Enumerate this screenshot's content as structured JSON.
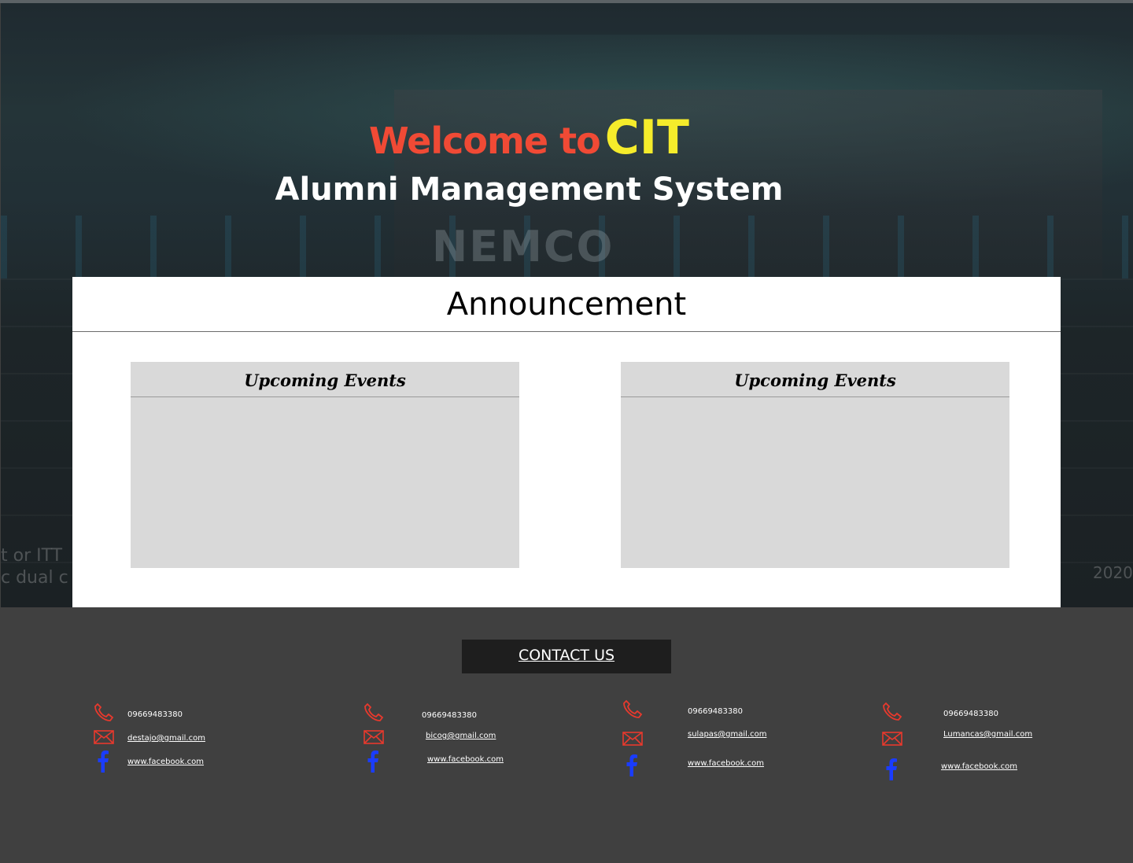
{
  "hero": {
    "welcome_text": "Welcome to",
    "brand_text": "CIT",
    "subtitle": "Alumni Management System",
    "bg_watermark": "NEMCO",
    "bg_side_text_1": "t or ITT",
    "bg_side_text_2": "c dual c",
    "bg_year": "2020"
  },
  "colors": {
    "welcome": "#f04a35",
    "brand": "#f5ec2b",
    "icon_red": "#e8392d",
    "facebook_blue": "#1a3cff",
    "footer_bg": "#404040"
  },
  "announcement": {
    "title": "Announcement",
    "cards": [
      {
        "title": "Upcoming Events"
      },
      {
        "title": "Upcoming Events"
      }
    ]
  },
  "footer": {
    "contact_label": "CONTACT US",
    "contacts": [
      {
        "phone": "09669483380",
        "email": "destajo@gmail.com",
        "facebook": "www.facebook.com"
      },
      {
        "phone": "09669483380",
        "email": "bicog@gmail.com",
        "facebook": "www.facebook.com"
      },
      {
        "phone": "09669483380",
        "email": "sulapas@gmail.com",
        "facebook": "www.facebook.com"
      },
      {
        "phone": "09669483380",
        "email": "Lumancas@gmail.com",
        "facebook": "www.facebook.com"
      }
    ],
    "icons": [
      "phone-icon",
      "mail-icon",
      "facebook-icon"
    ]
  }
}
